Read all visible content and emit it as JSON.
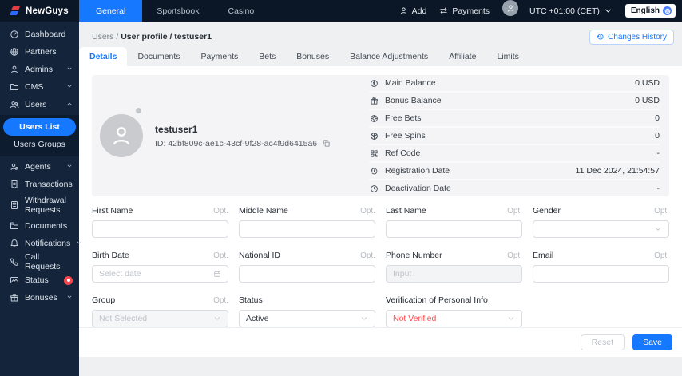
{
  "colors": {
    "accent": "#1677ff",
    "danger": "#ff4d4f",
    "header_bg": "#0b1726",
    "sidebar_bg": "#13243b"
  },
  "header": {
    "brand": "NewGuys",
    "nav_tabs": [
      {
        "label": "General"
      },
      {
        "label": "Sportsbook"
      },
      {
        "label": "Casino"
      }
    ],
    "add_label": "Add",
    "payments_label": "Payments",
    "timezone": "UTC +01:00 (CET)",
    "language": "English"
  },
  "sidebar": {
    "items": [
      {
        "label": "Dashboard"
      },
      {
        "label": "Partners"
      },
      {
        "label": "Admins"
      },
      {
        "label": "CMS"
      },
      {
        "label": "Users"
      },
      {
        "label": "Agents"
      },
      {
        "label": "Transactions"
      },
      {
        "label": "Withdrawal Requests"
      },
      {
        "label": "Documents"
      },
      {
        "label": "Notifications"
      },
      {
        "label": "Call Requests"
      },
      {
        "label": "Status"
      },
      {
        "label": "Bonuses"
      }
    ],
    "users_submenu": [
      {
        "label": "Users List"
      },
      {
        "label": "Users Groups"
      }
    ]
  },
  "breadcrumb": {
    "section": "Users",
    "separator": "/",
    "current": "User profile / testuser1"
  },
  "changes_history": {
    "label": "Changes History"
  },
  "tabs": [
    {
      "label": "Details"
    },
    {
      "label": "Documents"
    },
    {
      "label": "Payments"
    },
    {
      "label": "Bets"
    },
    {
      "label": "Bonuses"
    },
    {
      "label": "Balance Adjustments"
    },
    {
      "label": "Affiliate"
    },
    {
      "label": "Limits"
    }
  ],
  "profile": {
    "username": "testuser1",
    "user_id": "ID: 42bf809c-ae1c-43cf-9f28-ac4f9d6415a6",
    "info_rows": [
      {
        "label": "Main Balance",
        "value": "0 USD"
      },
      {
        "label": "Bonus Balance",
        "value": "0 USD"
      },
      {
        "label": "Free Bets",
        "value": "0"
      },
      {
        "label": "Free Spins",
        "value": "0"
      },
      {
        "label": "Ref Code",
        "value": "-"
      },
      {
        "label": "Registration Date",
        "value": "11 Dec 2024, 21:54:57"
      },
      {
        "label": "Deactivation Date",
        "value": "-"
      }
    ]
  },
  "form": {
    "rows": [
      [
        {
          "label": "First Name",
          "opt": "Opt.",
          "value": ""
        },
        {
          "label": "Middle Name",
          "opt": "Opt.",
          "value": ""
        },
        {
          "label": "Last Name",
          "opt": "Opt.",
          "value": ""
        },
        {
          "label": "Gender",
          "opt": "Opt.",
          "value": ""
        }
      ],
      [
        {
          "label": "Birth Date",
          "opt": "Opt.",
          "placeholder": "Select date"
        },
        {
          "label": "National ID",
          "opt": "Opt.",
          "value": ""
        },
        {
          "label": "Phone Number",
          "opt": "Opt.",
          "placeholder": "Input"
        },
        {
          "label": "Email",
          "opt": "Opt.",
          "value": ""
        }
      ],
      [
        {
          "label": "Group",
          "opt": "Opt.",
          "value": "Not Selected"
        },
        {
          "label": "Status",
          "value": "Active"
        },
        {
          "label": "Verification of Personal Info",
          "value": "Not Verified"
        }
      ]
    ]
  },
  "footer": {
    "reset": "Reset",
    "save": "Save"
  }
}
